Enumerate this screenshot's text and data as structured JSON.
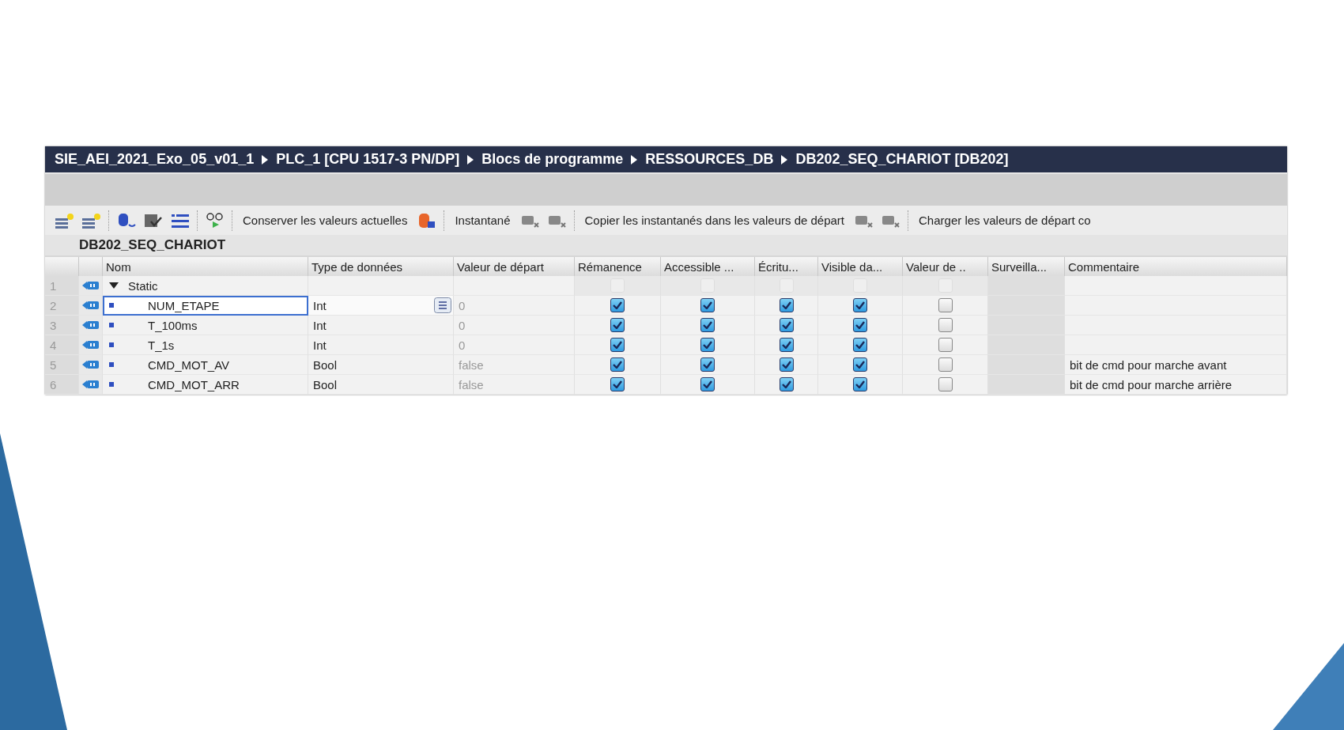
{
  "breadcrumb": [
    "SIE_AEI_2021_Exo_05_v01_1",
    "PLC_1 [CPU 1517-3 PN/DP]",
    "Blocs de programme",
    "RESSOURCES_DB",
    "DB202_SEQ_CHARIOT [DB202]"
  ],
  "toolbar": [
    {
      "kind": "text",
      "label": "Conserver les valeurs actuelles"
    },
    {
      "kind": "text",
      "label": "Instantané"
    },
    {
      "kind": "text",
      "label": "Copier les instantanés dans les valeurs de départ"
    },
    {
      "kind": "text",
      "label": "Charger les valeurs de départ co"
    }
  ],
  "block_title": "DB202_SEQ_CHARIOT",
  "table": {
    "columns": [
      "Nom",
      "Type de données",
      "Valeur de départ",
      "Rémanence",
      "Accessible ...",
      "Écritu...",
      "Visible da...",
      "Valeur de ..",
      "Surveilla...",
      "Commentaire"
    ],
    "rows": [
      {
        "number": "1",
        "kind": "group",
        "expanded": true,
        "name": "Static",
        "type": "",
        "start": "",
        "selected": false,
        "flags": [
          {
            "checked": false,
            "disabled": true
          },
          {
            "checked": false,
            "disabled": true
          },
          {
            "checked": false,
            "disabled": true
          },
          {
            "checked": false,
            "disabled": true
          },
          {
            "checked": false,
            "disabled": true
          }
        ],
        "comment": ""
      },
      {
        "number": "2",
        "kind": "var",
        "name": "NUM_ETAPE",
        "type": "Int",
        "start": "0",
        "selected": true,
        "flags": [
          {
            "checked": true,
            "disabled": false
          },
          {
            "checked": true,
            "disabled": false
          },
          {
            "checked": true,
            "disabled": false
          },
          {
            "checked": true,
            "disabled": false
          },
          {
            "checked": false,
            "disabled": false
          }
        ],
        "comment": ""
      },
      {
        "number": "3",
        "kind": "var",
        "name": "T_100ms",
        "type": "Int",
        "start": "0",
        "selected": false,
        "flags": [
          {
            "checked": true,
            "disabled": false
          },
          {
            "checked": true,
            "disabled": false
          },
          {
            "checked": true,
            "disabled": false
          },
          {
            "checked": true,
            "disabled": false
          },
          {
            "checked": false,
            "disabled": false
          }
        ],
        "comment": ""
      },
      {
        "number": "4",
        "kind": "var",
        "name": "T_1s",
        "type": "Int",
        "start": "0",
        "selected": false,
        "flags": [
          {
            "checked": true,
            "disabled": false
          },
          {
            "checked": true,
            "disabled": false
          },
          {
            "checked": true,
            "disabled": false
          },
          {
            "checked": true,
            "disabled": false
          },
          {
            "checked": false,
            "disabled": false
          }
        ],
        "comment": ""
      },
      {
        "number": "5",
        "kind": "var",
        "name": "CMD_MOT_AV",
        "type": "Bool",
        "start": "false",
        "selected": false,
        "flags": [
          {
            "checked": true,
            "disabled": false
          },
          {
            "checked": true,
            "disabled": false
          },
          {
            "checked": true,
            "disabled": false
          },
          {
            "checked": true,
            "disabled": false
          },
          {
            "checked": false,
            "disabled": false
          }
        ],
        "comment": "bit de cmd pour marche avant"
      },
      {
        "number": "6",
        "kind": "var",
        "name": "CMD_MOT_ARR",
        "type": "Bool",
        "start": "false",
        "selected": false,
        "flags": [
          {
            "checked": true,
            "disabled": false
          },
          {
            "checked": true,
            "disabled": false
          },
          {
            "checked": true,
            "disabled": false
          },
          {
            "checked": true,
            "disabled": false
          },
          {
            "checked": false,
            "disabled": false
          }
        ],
        "comment": "bit de cmd pour marche arrière"
      }
    ]
  }
}
